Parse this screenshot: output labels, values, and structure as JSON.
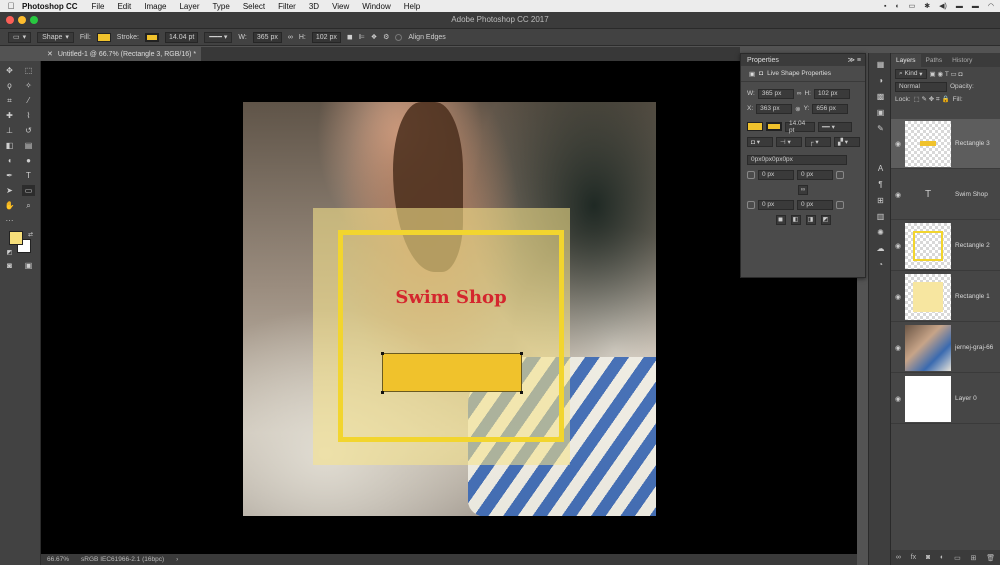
{
  "menubar": {
    "app_name": "Photoshop CC",
    "items": [
      "File",
      "Edit",
      "Image",
      "Layer",
      "Type",
      "Select",
      "Filter",
      "3D",
      "View",
      "Window",
      "Help"
    ]
  },
  "window": {
    "title": "Adobe Photoshop CC 2017"
  },
  "options_bar": {
    "mode": "Shape",
    "fill_label": "Fill:",
    "stroke_label": "Stroke:",
    "stroke_width": "14.04 pt",
    "w_label": "W:",
    "w_value": "365 px",
    "h_label": "H:",
    "h_value": "102 px",
    "align_edges": "Align Edges",
    "fill_color": "#f0c22c",
    "stroke_color": "#f0c22c"
  },
  "document_tab": {
    "label": "Untitled-1 @ 66.7% (Rectangle 3, RGB/16) *"
  },
  "canvas": {
    "headline": "Swim Shop"
  },
  "status_bar": {
    "zoom": "66.67%",
    "profile": "sRGB IEC61966-2.1 (16bpc)"
  },
  "properties": {
    "title": "Properties",
    "section": "Live Shape Properties",
    "w_label": "W:",
    "w_value": "365 px",
    "h_label": "H:",
    "h_value": "102 px",
    "x_label": "X:",
    "x_value": "363 px",
    "y_label": "Y:",
    "y_value": "656 px",
    "stroke_width": "14.04 pt",
    "radii": "0px0px0px0px",
    "corner_tl": "0 px",
    "corner_tr": "0 px",
    "corner_bl": "0 px",
    "corner_br": "0 px"
  },
  "layers_panel": {
    "tabs": [
      "Layers",
      "Paths",
      "History"
    ],
    "kind": "Kind",
    "blend": "Normal",
    "opacity_label": "Opacity:",
    "lock_label": "Lock:",
    "fill_label": "Fill:",
    "layers": [
      {
        "name": "Rectangle 3"
      },
      {
        "name": "Swim Shop"
      },
      {
        "name": "Rectangle 2"
      },
      {
        "name": "Rectangle 1"
      },
      {
        "name": "jernej-graj-66"
      },
      {
        "name": "Layer 0"
      }
    ]
  }
}
